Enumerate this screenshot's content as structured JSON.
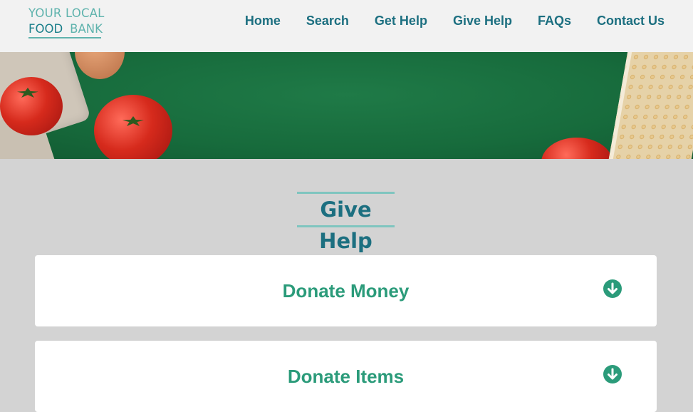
{
  "brand": {
    "line1": "YOUR LOCAL",
    "line2a": "FOOD",
    "line2b": "BANK",
    "accent": "#5fb3ad"
  },
  "nav": {
    "items": [
      {
        "label": "Home"
      },
      {
        "label": "Search"
      },
      {
        "label": "Get Help"
      },
      {
        "label": "Give Help"
      },
      {
        "label": "FAQs"
      },
      {
        "label": "Contact Us"
      }
    ]
  },
  "page": {
    "title": "Give Help"
  },
  "accordion": {
    "items": [
      {
        "label": "Donate Money",
        "icon": "arrow-down-circle-icon"
      },
      {
        "label": "Donate Items",
        "icon": "arrow-down-circle-icon"
      }
    ]
  },
  "colors": {
    "nav_text": "#1c6f80",
    "accordion_text": "#2b9b7a",
    "page_bg": "#d3d3d3"
  }
}
